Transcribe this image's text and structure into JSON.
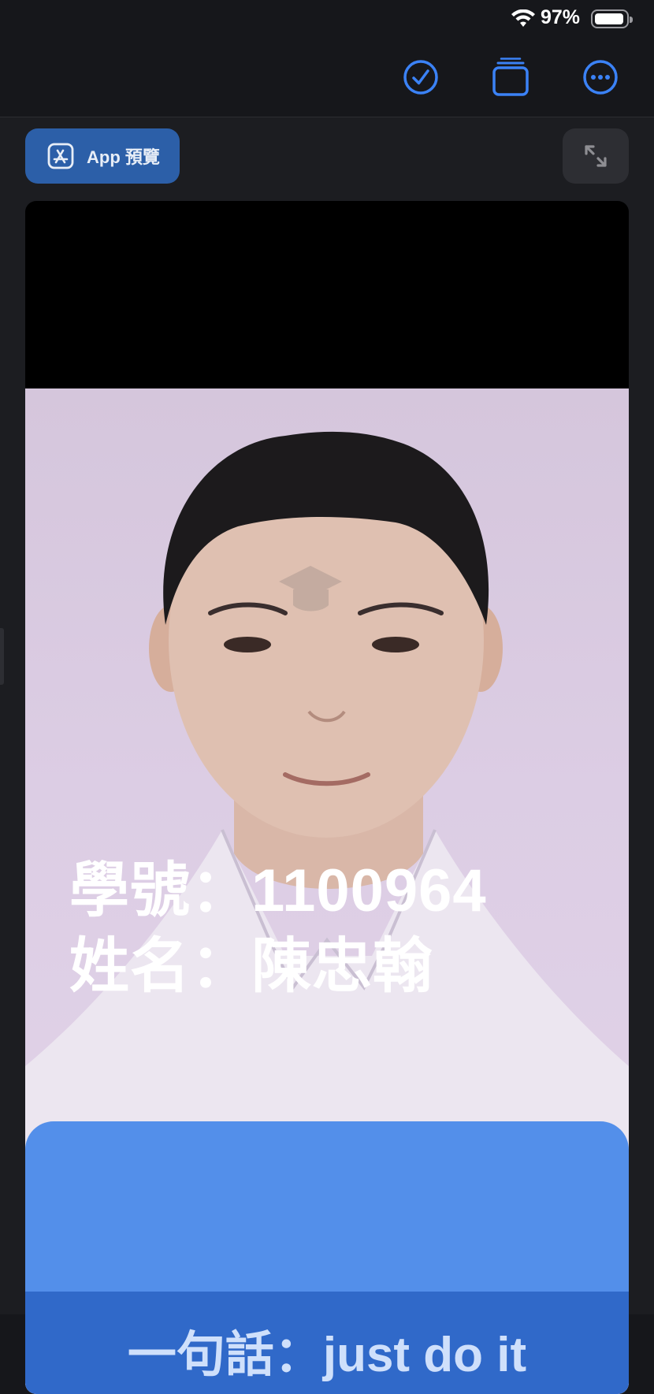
{
  "status_bar": {
    "battery_percent": "97%",
    "icons": [
      "wifi-icon",
      "battery-icon"
    ]
  },
  "toolbar": {
    "icons": [
      "checkmark-circle-icon",
      "stack-icon",
      "more-circle-icon"
    ],
    "accent_color": "#3b82f6"
  },
  "preview": {
    "button_label": "App 預覽",
    "button_icon": "app-store-icon",
    "expand_icon": "expand-arrows-icon"
  },
  "card": {
    "student_id_line": "學號：1100964",
    "name_line": "姓名：陳忠翰",
    "quote_line": "一句話：just do it",
    "watermark_icon": "graduation-cap-icon",
    "colors": {
      "panel": "#4788ea",
      "footer": "#3069c9"
    }
  }
}
